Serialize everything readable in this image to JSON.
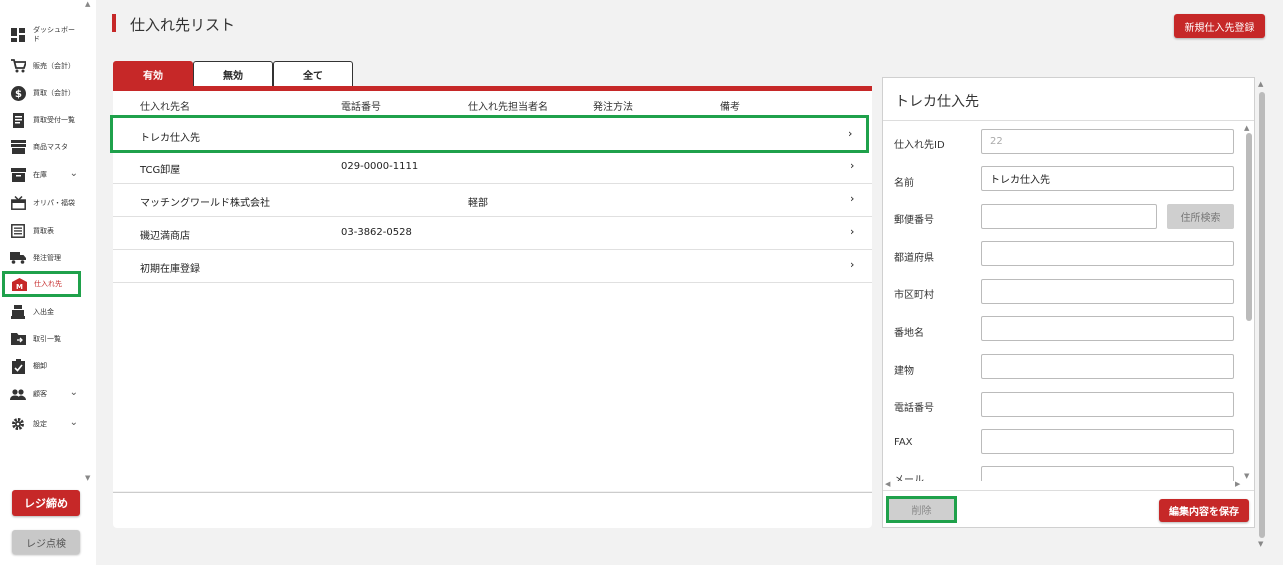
{
  "sidebar": {
    "items": [
      {
        "label": "ダッシュボード",
        "icon": "dashboard-icon"
      },
      {
        "label": "販売（会計）",
        "icon": "cart-icon"
      },
      {
        "label": "買取（会計）",
        "icon": "dollar-icon"
      },
      {
        "label": "買取受付一覧",
        "icon": "receipt-icon"
      },
      {
        "label": "商品マスタ",
        "icon": "store-icon"
      },
      {
        "label": "在庫",
        "icon": "inventory-icon",
        "expandable": true
      },
      {
        "label": "オリパ・福袋",
        "icon": "gift-icon"
      },
      {
        "label": "買取表",
        "icon": "list-icon"
      },
      {
        "label": "発注管理",
        "icon": "truck-icon"
      },
      {
        "label": "仕入れ先",
        "icon": "warehouse-icon",
        "active": true
      },
      {
        "label": "入出金",
        "icon": "register-icon"
      },
      {
        "label": "取引一覧",
        "icon": "folder-icon"
      },
      {
        "label": "棚卸",
        "icon": "clipboard-icon"
      },
      {
        "label": "顧客",
        "icon": "people-icon",
        "expandable": true
      },
      {
        "label": "設定",
        "icon": "gear-icon",
        "expandable": true
      }
    ],
    "close_register": "レジ締め",
    "check_register": "レジ点検"
  },
  "header": {
    "title": "仕入れ先リスト",
    "new_button": "新規仕入先登録"
  },
  "tabs": [
    "有効",
    "無効",
    "全て"
  ],
  "table": {
    "columns": [
      "仕入れ先名",
      "電話番号",
      "仕入れ先担当者名",
      "発注方法",
      "備考"
    ],
    "rows": [
      {
        "name": "トレカ仕入先",
        "phone": "",
        "contact": "",
        "method": "",
        "note": ""
      },
      {
        "name": "TCG卸屋",
        "phone": "029-0000-1111",
        "contact": "",
        "method": "",
        "note": ""
      },
      {
        "name": "マッチングワールド株式会社",
        "phone": "",
        "contact": "軽部",
        "method": "",
        "note": ""
      },
      {
        "name": "磯辺満商店",
        "phone": "03-3862-0528",
        "contact": "",
        "method": "",
        "note": ""
      },
      {
        "name": "初期在庫登録",
        "phone": "",
        "contact": "",
        "method": "",
        "note": ""
      }
    ]
  },
  "detail": {
    "title": "トレカ仕入先",
    "fields": {
      "id_label": "仕入れ先ID",
      "id_value": "22",
      "name_label": "名前",
      "name_value": "トレカ仕入先",
      "zip_label": "郵便番号",
      "zip_value": "",
      "address_search": "住所検索",
      "pref_label": "都道府県",
      "pref_value": "",
      "city_label": "市区町村",
      "city_value": "",
      "street_label": "番地名",
      "street_value": "",
      "building_label": "建物",
      "building_value": "",
      "phone_label": "電話番号",
      "phone_value": "",
      "fax_label": "FAX",
      "fax_value": "",
      "email_label": "メール"
    },
    "delete_button": "削除",
    "save_button": "編集内容を保存"
  },
  "colors": {
    "accent": "#c62828",
    "highlight": "#1fa14b"
  }
}
